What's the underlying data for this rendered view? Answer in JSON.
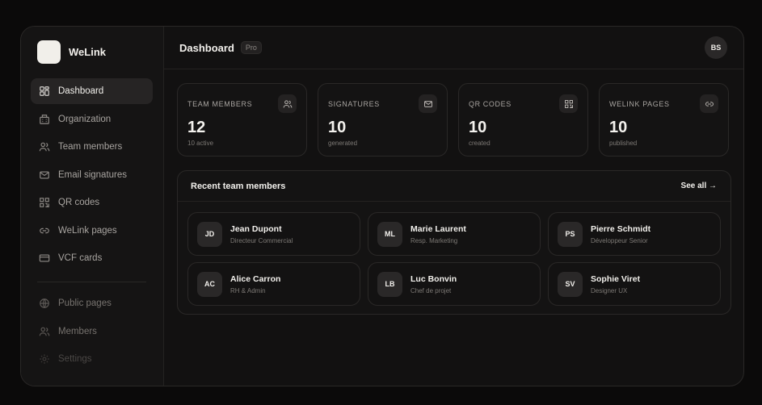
{
  "brand": {
    "name": "WeLink"
  },
  "nav": {
    "primary": [
      {
        "label": "Dashboard",
        "icon": "dashboard-icon"
      },
      {
        "label": "Organization",
        "icon": "building-icon"
      },
      {
        "label": "Team members",
        "icon": "users-icon"
      },
      {
        "label": "Email signatures",
        "icon": "mail-icon"
      },
      {
        "label": "QR codes",
        "icon": "qr-icon"
      },
      {
        "label": "WeLink pages",
        "icon": "link-icon"
      },
      {
        "label": "VCF cards",
        "icon": "card-icon"
      }
    ],
    "secondary": [
      {
        "label": "Public pages",
        "icon": "globe-icon"
      },
      {
        "label": "Members",
        "icon": "users-icon"
      },
      {
        "label": "Settings",
        "icon": "gear-icon"
      }
    ]
  },
  "header": {
    "title": "Dashboard",
    "badge": "Pro",
    "user_initials": "BS"
  },
  "stats": [
    {
      "label": "TEAM MEMBERS",
      "value": "12",
      "sub": "10 active",
      "icon": "users-icon"
    },
    {
      "label": "SIGNATURES",
      "value": "10",
      "sub": "generated",
      "icon": "mail-icon"
    },
    {
      "label": "QR CODES",
      "value": "10",
      "sub": "created",
      "icon": "qr-icon"
    },
    {
      "label": "WELINK PAGES",
      "value": "10",
      "sub": "published",
      "icon": "link-icon"
    }
  ],
  "recent": {
    "title": "Recent team members",
    "see_all": "See all →",
    "members": [
      {
        "initials": "JD",
        "name": "Jean Dupont",
        "role": "Directeur Commercial"
      },
      {
        "initials": "ML",
        "name": "Marie Laurent",
        "role": "Resp. Marketing"
      },
      {
        "initials": "PS",
        "name": "Pierre Schmidt",
        "role": "Développeur Senior"
      },
      {
        "initials": "AC",
        "name": "Alice Carron",
        "role": "RH & Admin"
      },
      {
        "initials": "LB",
        "name": "Luc Bonvin",
        "role": "Chef de projet"
      },
      {
        "initials": "SV",
        "name": "Sophie Viret",
        "role": "Designer UX"
      }
    ]
  }
}
